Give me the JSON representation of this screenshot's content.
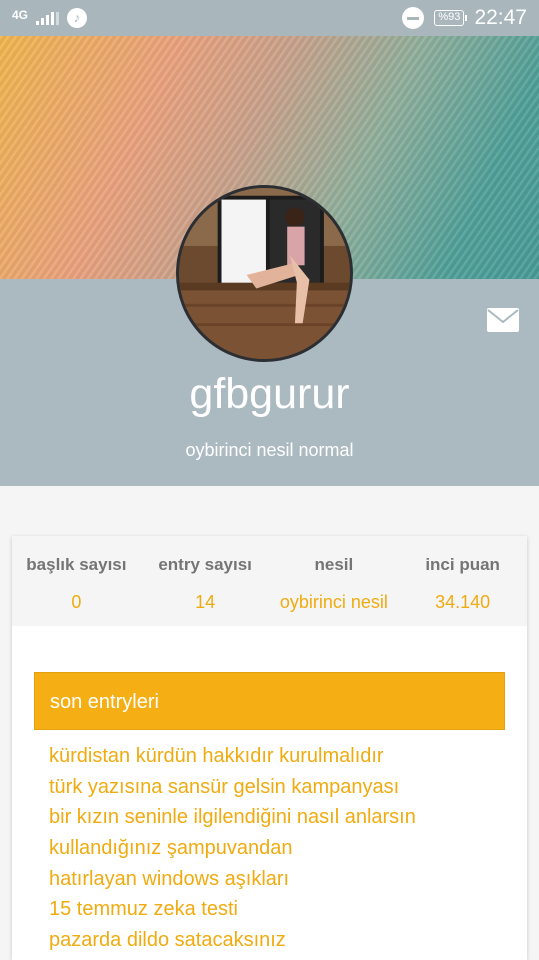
{
  "status_bar": {
    "network": "4G",
    "battery": "%93",
    "time": "22:47",
    "icons": [
      "signal-icon",
      "music-icon",
      "dnd-icon",
      "battery-icon"
    ]
  },
  "profile": {
    "username": "gfbgurur",
    "title": "oybirinci nesil normal",
    "mail_icon": "mail-icon"
  },
  "stats": [
    {
      "label": "başlık sayısı",
      "value": "0"
    },
    {
      "label": "entry sayısı",
      "value": "14"
    },
    {
      "label": "nesil",
      "value": "oybirinci nesil"
    },
    {
      "label": "inci puan",
      "value": "34.140"
    }
  ],
  "recent": {
    "header": "son entryleri",
    "entries": [
      "kürdistan kürdün hakkıdır kurulmalıdır",
      "türk yazısına sansür gelsin kampanyası",
      "bir kızın seninle ilgilendiğini nasıl anlarsın",
      "kullandığınız şampuvandan",
      "hatırlayan windows aşıkları",
      "15 temmuz zeka testi",
      "pazarda dildo satacaksınız"
    ]
  },
  "colors": {
    "accent": "#f0ab10",
    "header_bg": "#abbac0",
    "section_header_bg": "#f5af15"
  }
}
